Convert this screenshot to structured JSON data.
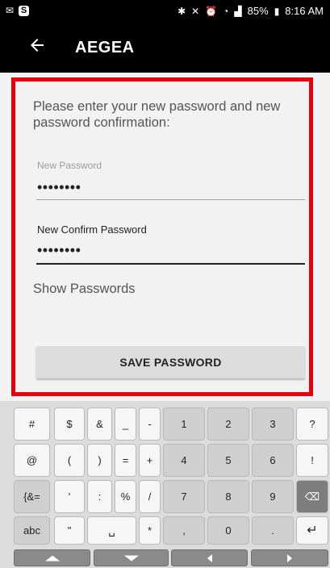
{
  "status_bar": {
    "battery": "85%",
    "time": "8:16 AM"
  },
  "app_bar": {
    "title": "AEGEA"
  },
  "form": {
    "instructions": "Please enter your new password and new password confirmation:",
    "new_password_label": "New Password",
    "new_password_value": "••••••••",
    "confirm_password_label": "New Confirm Password",
    "confirm_password_value": "••••••••",
    "show_passwords_label": "Show Passwords",
    "save_button_label": "SAVE PASSWORD"
  },
  "keyboard": {
    "rows": [
      [
        "#",
        "$",
        "&",
        "_",
        "-",
        "1",
        "2",
        "3",
        "?"
      ],
      [
        "@",
        "(",
        ")",
        "=",
        "+",
        "4",
        "5",
        "6",
        "!"
      ],
      [
        "{&=",
        "'",
        ":",
        "%",
        "/",
        "7",
        "8",
        "9",
        "⌫"
      ],
      [
        "abc",
        "\"",
        "␣",
        "*",
        ",",
        "0",
        ".",
        "↵"
      ]
    ]
  },
  "colors": {
    "highlight": "#e8000b",
    "app_bar": "#000000",
    "content_bg": "#f2f2f2"
  }
}
